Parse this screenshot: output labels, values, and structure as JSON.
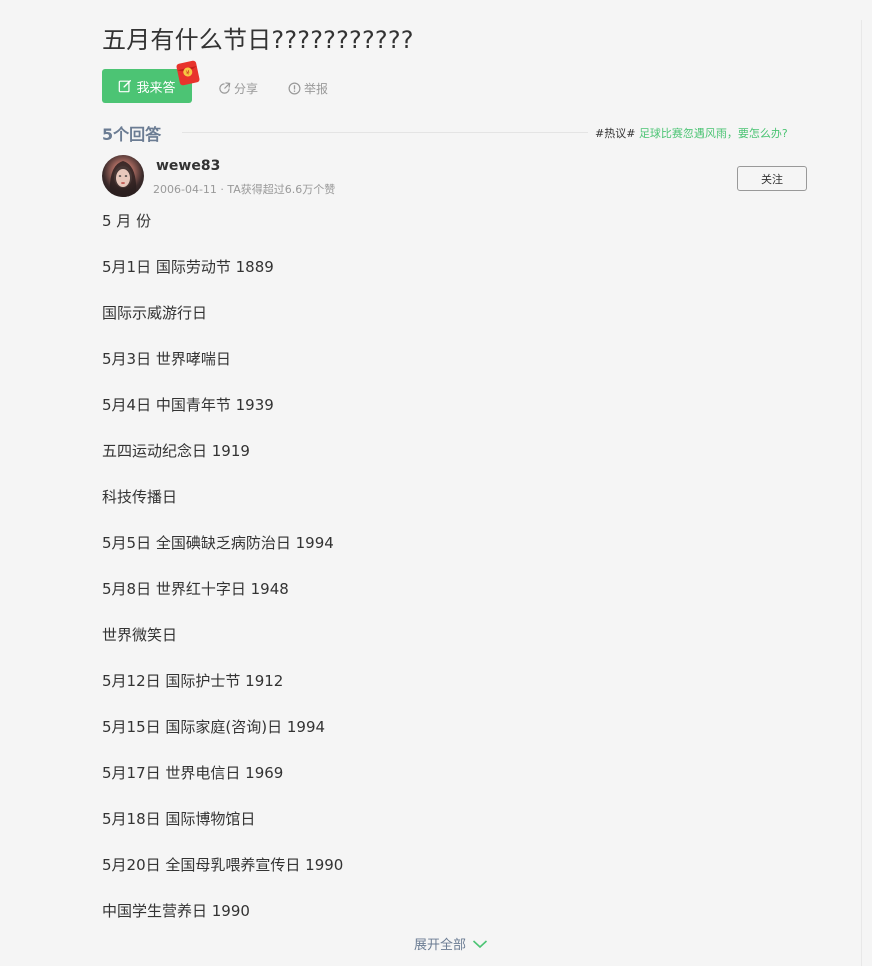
{
  "question": {
    "title": "五月有什么节日???????????"
  },
  "actions": {
    "answer_label": "我来答",
    "share_label": "分享",
    "report_label": "举报"
  },
  "answers_header": {
    "count_label": "5个回答",
    "hot_tag": "#热议#",
    "hot_link": "足球比赛忽遇风雨，要怎么办?"
  },
  "answer": {
    "author": "wewe83",
    "meta": "2006-04-11 · TA获得超过6.6万个赞",
    "follow_label": "关注",
    "lines": [
      "5 月 份",
      "5月1日 国际劳动节 1889",
      "国际示威游行日",
      "5月3日 世界哮喘日",
      "5月4日 中国青年节 1939",
      "五四运动纪念日 1919",
      "科技传播日",
      "5月5日 全国碘缺乏病防治日 1994",
      "5月8日 世界红十字日 1948",
      "世界微笑日",
      "5月12日 国际护士节 1912",
      "5月15日 国际家庭(咨询)日 1994",
      "5月17日 世界电信日 1969",
      "5月18日 国际博物馆日",
      "5月20日 全国母乳喂养宣传日 1990",
      "中国学生营养日 1990"
    ],
    "expand_label": "展开全部"
  },
  "colors": {
    "accent": "#4cc474",
    "muted": "#999999",
    "header_gray": "#6b7c93",
    "background": "#f5f5f5"
  },
  "icons": {
    "answer": "edit-icon",
    "redpacket": "red-envelope-icon",
    "share": "share-icon",
    "report": "report-icon",
    "expand": "chevron-down-icon"
  }
}
